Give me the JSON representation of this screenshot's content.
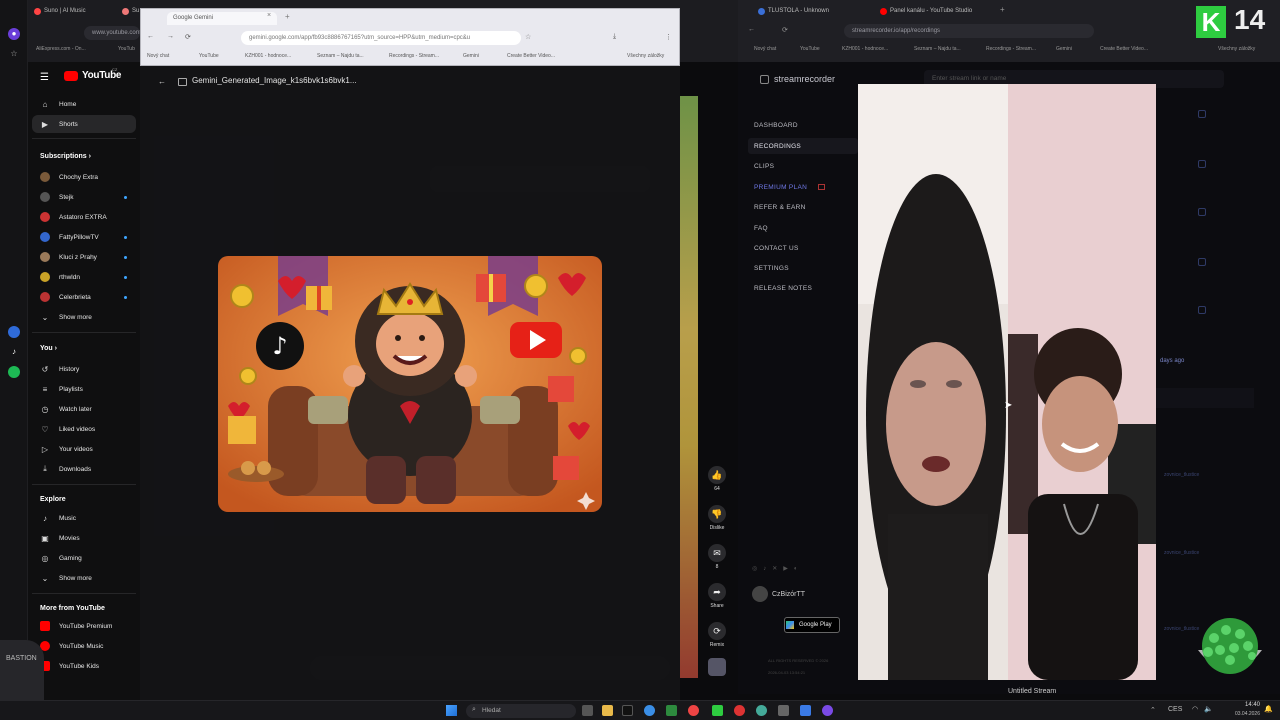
{
  "left_browser": {
    "tabs": [
      {
        "label": "Suno | AI Music",
        "color": "#f44"
      },
      {
        "label": "Su",
        "color": "#e77"
      }
    ],
    "address": "www.youtube.com/shorts",
    "bookmarks": [
      "AliExpress.com - On...",
      "YouTub"
    ]
  },
  "gemini_browser": {
    "tab_label": "Google Gemini",
    "address": "gemini.google.com/app/fb93c8886767165?utm_source=HPP&utm_medium=cpc&u",
    "bookmarks": [
      "Nový chat",
      "YouTube",
      "KZH001 - hodnoce...",
      "Seznam – Najdu ta...",
      "Recordings - Stream...",
      "Gemini",
      "Create Better Video...",
      "Všechny záložky"
    ],
    "image_title": "Gemini_Generated_Image_k1s6bvk1s6bvk1..."
  },
  "youtube": {
    "logo": "YouTube",
    "logo_sup": "CZ",
    "nav": [
      {
        "label": "Home",
        "icon": "home-icon",
        "glyph": "⌂"
      },
      {
        "label": "Shorts",
        "icon": "shorts-icon",
        "glyph": "▶"
      }
    ],
    "subscriptions_title": "Subscriptions",
    "subscriptions": [
      {
        "label": "Chochy Extra",
        "color": "#7a5a3a",
        "dot": false
      },
      {
        "label": "Stejk",
        "color": "#555",
        "dot": true
      },
      {
        "label": "Astatoro EXTRA",
        "color": "#c33",
        "dot": false
      },
      {
        "label": "FattyPillowTV",
        "color": "#36c",
        "dot": true
      },
      {
        "label": "Kluci z Prahy",
        "color": "#9a7a5a",
        "dot": true
      },
      {
        "label": "rthwldn",
        "color": "#c9a227",
        "dot": true
      },
      {
        "label": "Celerbrieta",
        "color": "#b33",
        "dot": true
      }
    ],
    "show_more": "Show more",
    "you_title": "You",
    "you_items": [
      {
        "label": "History",
        "glyph": "↺",
        "icon": "history-icon"
      },
      {
        "label": "Playlists",
        "glyph": "≡",
        "icon": "playlists-icon"
      },
      {
        "label": "Watch later",
        "glyph": "◷",
        "icon": "watch-later-icon"
      },
      {
        "label": "Liked videos",
        "glyph": "♡",
        "icon": "like-icon"
      },
      {
        "label": "Your videos",
        "glyph": "▷",
        "icon": "your-videos-icon"
      },
      {
        "label": "Downloads",
        "glyph": "⤓",
        "icon": "download-icon"
      }
    ],
    "explore_title": "Explore",
    "explore_items": [
      {
        "label": "Music",
        "glyph": "♪",
        "icon": "music-icon"
      },
      {
        "label": "Movies",
        "glyph": "▣",
        "icon": "movies-icon"
      },
      {
        "label": "Gaming",
        "glyph": "◎",
        "icon": "gaming-icon"
      }
    ],
    "show_more_2": "Show more",
    "more_title": "More from YouTube",
    "more_items": [
      {
        "label": "YouTube Premium"
      },
      {
        "label": "YouTube Music"
      },
      {
        "label": "YouTube Kids"
      }
    ]
  },
  "shorts_actions": [
    {
      "label": "64",
      "glyph": "👍",
      "icon": "like-icon"
    },
    {
      "label": "Dislike",
      "glyph": "👎",
      "icon": "dislike-icon"
    },
    {
      "label": "8",
      "glyph": "✉",
      "icon": "comment-icon"
    },
    {
      "label": "Share",
      "glyph": "➦",
      "icon": "share-icon"
    },
    {
      "label": "Remix",
      "glyph": "⟳",
      "icon": "remix-icon"
    }
  ],
  "right_browser": {
    "tabs": [
      "TLUSTOLA - Unknown",
      "Panel kanálu - YouTube Studio"
    ],
    "address": "streamrecorder.io/app/recordings",
    "bookmarks": [
      "Nový chat",
      "YouTube",
      "KZH001 - hodnoce...",
      "Seznam – Najdu ta...",
      "Recordings - Stream...",
      "Gemini",
      "Create Better Video...",
      "Všechny záložky"
    ]
  },
  "streamrecorder": {
    "brand": "streamrecorder",
    "search_placeholder": "Enter stream link or name",
    "nav": [
      "DASHBOARD",
      "RECORDINGS",
      "CLIPS",
      "PREMIUM PLAN",
      "REFER & EARN",
      "FAQ",
      "CONTACT US",
      "SETTINGS",
      "RELEASE NOTES"
    ],
    "user": "CzBizórTT",
    "store_badge": "Google Play",
    "footer": "ALL RIGHTS RESERVED © 2026",
    "footer_date": "2026-04-03 13:54:21",
    "stream_title": "Untitled Stream",
    "days_ago_label": "days ago",
    "side_texts": [
      "zovnice_tlustice",
      "zovnice_tlustice",
      "zovnice_tlustice"
    ]
  },
  "overlay": {
    "logo_letter": "K",
    "logo_number": "14",
    "watermark": "BASTION"
  },
  "taskbar": {
    "search": "Hledat",
    "lang": "CES",
    "time": "14:40",
    "date": "03.04.2026"
  }
}
